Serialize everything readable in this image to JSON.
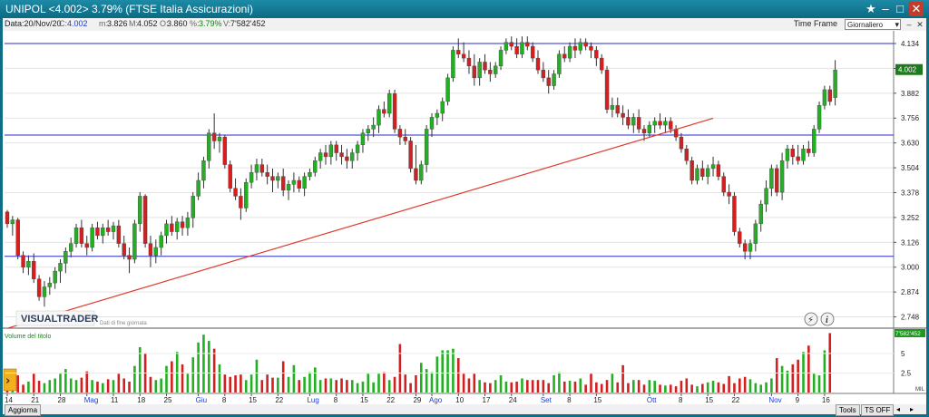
{
  "window": {
    "title": "UNIPOL <4.002> 3.79%  (FTSE Italia Assicurazioni)",
    "star_icon": "star-icon",
    "minimize_label": "–",
    "maximize_label": "□",
    "close_label": "✕"
  },
  "info": {
    "data": "Data:20/Nov/20",
    "close_label": "C:",
    "close": "4.002",
    "min_label": "m:",
    "min": "3.826",
    "max_label": "M:",
    "max": "4.052",
    "open_label": "O:",
    "open": "3.860",
    "pct_label": "%:",
    "pct": "3.79%",
    "vol_label": "V:",
    "vol": "7'582'452",
    "timeframe_label": "Time Frame",
    "timeframe_value": "Giornaliero",
    "colors": {
      "close": "#1a3ad6",
      "pct": "#0a8a0a"
    }
  },
  "status": {
    "aggiorna": "Aggiorna",
    "tools": "Tools",
    "ts_off": "TS OFF",
    "arrow_left": "◂",
    "arrow_right": "▸"
  },
  "chart_data": {
    "type": "candlestick",
    "price_axis": {
      "ticks": [
        "4.134",
        "4.008",
        "3.882",
        "3.756",
        "3.630",
        "3.504",
        "3.378",
        "3.252",
        "3.126",
        "3.000",
        "2.874",
        "2.748"
      ],
      "range": [
        2.7,
        4.18
      ]
    },
    "current_price_label": "4.002",
    "horizontal_lines": [
      4.134,
      3.67,
      3.055
    ],
    "trendline": {
      "from": [
        0,
        2.69
      ],
      "to": [
        133,
        3.755
      ]
    },
    "watermark": "VISUALTRADER",
    "watermark_sub": "Dati di fine giornata",
    "volume_pane": {
      "label": "Volume del titolo",
      "ticks": [
        "5",
        "2.5"
      ],
      "unit": "MIL",
      "last_label": "7'582'452",
      "range": [
        0,
        8
      ]
    },
    "x_ticks": [
      {
        "i": 0,
        "label": "14",
        "month": false
      },
      {
        "i": 5,
        "label": "21",
        "month": false
      },
      {
        "i": 10,
        "label": "28",
        "month": false
      },
      {
        "i": 15,
        "label": "Mag",
        "month": true
      },
      {
        "i": 20,
        "label": "11",
        "month": false
      },
      {
        "i": 25,
        "label": "18",
        "month": false
      },
      {
        "i": 30,
        "label": "25",
        "month": false
      },
      {
        "i": 36,
        "label": "Giu",
        "month": true
      },
      {
        "i": 41,
        "label": "8",
        "month": false
      },
      {
        "i": 46,
        "label": "15",
        "month": false
      },
      {
        "i": 51,
        "label": "22",
        "month": false
      },
      {
        "i": 57,
        "label": "Lug",
        "month": true
      },
      {
        "i": 62,
        "label": "8",
        "month": false
      },
      {
        "i": 67,
        "label": "15",
        "month": false
      },
      {
        "i": 72,
        "label": "22",
        "month": false
      },
      {
        "i": 77,
        "label": "29",
        "month": false
      },
      {
        "i": 80,
        "label": "Ago",
        "month": true
      },
      {
        "i": 85,
        "label": "10",
        "month": false
      },
      {
        "i": 90,
        "label": "17",
        "month": false
      },
      {
        "i": 95,
        "label": "24",
        "month": false
      },
      {
        "i": 101,
        "label": "Set",
        "month": true
      },
      {
        "i": 106,
        "label": "8",
        "month": false
      },
      {
        "i": 111,
        "label": "15",
        "month": false
      },
      {
        "i": 121,
        "label": "Ott",
        "month": true
      },
      {
        "i": 127,
        "label": "8",
        "month": false
      },
      {
        "i": 132,
        "label": "15",
        "month": false
      },
      {
        "i": 137,
        "label": "22",
        "month": false
      },
      {
        "i": 144,
        "label": "Nov",
        "month": true
      },
      {
        "i": 149,
        "label": "9",
        "month": false
      },
      {
        "i": 154,
        "label": "16",
        "month": false
      }
    ],
    "candles": [
      [
        3.28,
        3.29,
        3.2,
        3.22
      ],
      [
        3.22,
        3.26,
        3.16,
        3.24
      ],
      [
        3.24,
        3.25,
        3.04,
        3.06
      ],
      [
        3.06,
        3.08,
        2.97,
        3.0
      ],
      [
        3.0,
        3.06,
        2.96,
        3.03
      ],
      [
        3.03,
        3.07,
        2.92,
        2.94
      ],
      [
        2.94,
        2.96,
        2.83,
        2.85
      ],
      [
        2.85,
        2.93,
        2.8,
        2.9
      ],
      [
        2.9,
        2.95,
        2.86,
        2.92
      ],
      [
        2.92,
        3.0,
        2.89,
        2.98
      ],
      [
        2.98,
        3.04,
        2.92,
        3.02
      ],
      [
        3.02,
        3.1,
        2.97,
        3.08
      ],
      [
        3.08,
        3.15,
        3.05,
        3.12
      ],
      [
        3.12,
        3.22,
        3.1,
        3.2
      ],
      [
        3.2,
        3.24,
        3.1,
        3.12
      ],
      [
        3.12,
        3.16,
        3.06,
        3.1
      ],
      [
        3.1,
        3.22,
        3.08,
        3.2
      ],
      [
        3.2,
        3.23,
        3.14,
        3.16
      ],
      [
        3.16,
        3.22,
        3.12,
        3.2
      ],
      [
        3.2,
        3.24,
        3.16,
        3.18
      ],
      [
        3.18,
        3.23,
        3.14,
        3.21
      ],
      [
        3.21,
        3.24,
        3.1,
        3.12
      ],
      [
        3.12,
        3.16,
        3.04,
        3.06
      ],
      [
        3.06,
        3.1,
        2.97,
        3.04
      ],
      [
        3.04,
        3.24,
        3.02,
        3.22
      ],
      [
        3.22,
        3.38,
        3.18,
        3.36
      ],
      [
        3.36,
        3.37,
        3.1,
        3.12
      ],
      [
        3.12,
        3.16,
        3.0,
        3.06
      ],
      [
        3.06,
        3.14,
        3.02,
        3.1
      ],
      [
        3.1,
        3.18,
        3.06,
        3.16
      ],
      [
        3.16,
        3.24,
        3.12,
        3.22
      ],
      [
        3.22,
        3.26,
        3.16,
        3.18
      ],
      [
        3.18,
        3.25,
        3.14,
        3.23
      ],
      [
        3.23,
        3.26,
        3.16,
        3.2
      ],
      [
        3.2,
        3.28,
        3.16,
        3.25
      ],
      [
        3.25,
        3.38,
        3.2,
        3.36
      ],
      [
        3.36,
        3.48,
        3.34,
        3.44
      ],
      [
        3.44,
        3.56,
        3.4,
        3.54
      ],
      [
        3.54,
        3.7,
        3.5,
        3.68
      ],
      [
        3.68,
        3.78,
        3.6,
        3.64
      ],
      [
        3.64,
        3.68,
        3.58,
        3.66
      ],
      [
        3.66,
        3.67,
        3.5,
        3.52
      ],
      [
        3.52,
        3.54,
        3.38,
        3.4
      ],
      [
        3.4,
        3.45,
        3.34,
        3.36
      ],
      [
        3.36,
        3.4,
        3.24,
        3.3
      ],
      [
        3.3,
        3.45,
        3.28,
        3.43
      ],
      [
        3.43,
        3.52,
        3.4,
        3.48
      ],
      [
        3.48,
        3.55,
        3.44,
        3.52
      ],
      [
        3.52,
        3.55,
        3.46,
        3.48
      ],
      [
        3.48,
        3.52,
        3.42,
        3.46
      ],
      [
        3.46,
        3.5,
        3.38,
        3.44
      ],
      [
        3.44,
        3.48,
        3.4,
        3.46
      ],
      [
        3.46,
        3.5,
        3.36,
        3.39
      ],
      [
        3.39,
        3.44,
        3.34,
        3.42
      ],
      [
        3.42,
        3.48,
        3.38,
        3.44
      ],
      [
        3.44,
        3.46,
        3.38,
        3.4
      ],
      [
        3.4,
        3.48,
        3.36,
        3.46
      ],
      [
        3.46,
        3.5,
        3.44,
        3.48
      ],
      [
        3.48,
        3.56,
        3.46,
        3.54
      ],
      [
        3.54,
        3.6,
        3.5,
        3.58
      ],
      [
        3.58,
        3.62,
        3.52,
        3.56
      ],
      [
        3.56,
        3.64,
        3.52,
        3.62
      ],
      [
        3.62,
        3.64,
        3.54,
        3.58
      ],
      [
        3.58,
        3.62,
        3.52,
        3.56
      ],
      [
        3.56,
        3.6,
        3.5,
        3.54
      ],
      [
        3.54,
        3.6,
        3.5,
        3.58
      ],
      [
        3.58,
        3.64,
        3.54,
        3.62
      ],
      [
        3.62,
        3.7,
        3.58,
        3.68
      ],
      [
        3.68,
        3.72,
        3.64,
        3.7
      ],
      [
        3.7,
        3.76,
        3.66,
        3.72
      ],
      [
        3.72,
        3.82,
        3.68,
        3.8
      ],
      [
        3.8,
        3.84,
        3.76,
        3.78
      ],
      [
        3.78,
        3.9,
        3.76,
        3.88
      ],
      [
        3.88,
        3.9,
        3.68,
        3.7
      ],
      [
        3.7,
        3.72,
        3.62,
        3.66
      ],
      [
        3.66,
        3.7,
        3.62,
        3.64
      ],
      [
        3.64,
        3.66,
        3.48,
        3.5
      ],
      [
        3.5,
        3.62,
        3.42,
        3.44
      ],
      [
        3.44,
        3.54,
        3.42,
        3.52
      ],
      [
        3.52,
        3.72,
        3.48,
        3.7
      ],
      [
        3.7,
        3.78,
        3.66,
        3.76
      ],
      [
        3.76,
        3.8,
        3.72,
        3.78
      ],
      [
        3.78,
        3.86,
        3.74,
        3.84
      ],
      [
        3.84,
        3.98,
        3.82,
        3.96
      ],
      [
        3.96,
        4.12,
        3.94,
        4.1
      ],
      [
        4.1,
        4.16,
        4.06,
        4.08
      ],
      [
        4.08,
        4.14,
        4.04,
        4.06
      ],
      [
        4.06,
        4.1,
        3.98,
        4.02
      ],
      [
        4.02,
        4.08,
        3.92,
        3.96
      ],
      [
        3.96,
        4.06,
        3.92,
        4.04
      ],
      [
        4.04,
        4.08,
        3.98,
        4.0
      ],
      [
        4.0,
        4.04,
        3.94,
        3.98
      ],
      [
        3.98,
        4.04,
        3.96,
        4.02
      ],
      [
        4.02,
        4.12,
        4.0,
        4.1
      ],
      [
        4.1,
        4.16,
        4.08,
        4.14
      ],
      [
        4.14,
        4.17,
        4.1,
        4.12
      ],
      [
        4.12,
        4.16,
        4.06,
        4.08
      ],
      [
        4.08,
        4.17,
        4.06,
        4.14
      ],
      [
        4.14,
        4.17,
        4.1,
        4.12
      ],
      [
        4.12,
        4.14,
        4.04,
        4.06
      ],
      [
        4.06,
        4.1,
        3.98,
        4.0
      ],
      [
        4.0,
        4.04,
        3.94,
        3.96
      ],
      [
        3.96,
        4.0,
        3.88,
        3.92
      ],
      [
        3.92,
        4.0,
        3.9,
        3.98
      ],
      [
        3.98,
        4.1,
        3.96,
        4.08
      ],
      [
        4.08,
        4.12,
        4.04,
        4.06
      ],
      [
        4.06,
        4.14,
        4.04,
        4.12
      ],
      [
        4.12,
        4.16,
        4.06,
        4.1
      ],
      [
        4.1,
        4.16,
        4.08,
        4.14
      ],
      [
        4.14,
        4.16,
        4.1,
        4.12
      ],
      [
        4.12,
        4.14,
        4.06,
        4.1
      ],
      [
        4.1,
        4.12,
        4.02,
        4.06
      ],
      [
        4.06,
        4.08,
        3.98,
        4.0
      ],
      [
        4.0,
        4.02,
        3.78,
        3.8
      ],
      [
        3.8,
        3.86,
        3.76,
        3.82
      ],
      [
        3.82,
        3.86,
        3.76,
        3.78
      ],
      [
        3.78,
        3.82,
        3.72,
        3.76
      ],
      [
        3.76,
        3.8,
        3.7,
        3.72
      ],
      [
        3.72,
        3.78,
        3.68,
        3.76
      ],
      [
        3.76,
        3.8,
        3.68,
        3.7
      ],
      [
        3.7,
        3.72,
        3.64,
        3.68
      ],
      [
        3.68,
        3.74,
        3.66,
        3.72
      ],
      [
        3.72,
        3.76,
        3.68,
        3.74
      ],
      [
        3.74,
        3.78,
        3.7,
        3.72
      ],
      [
        3.72,
        3.76,
        3.68,
        3.74
      ],
      [
        3.74,
        3.76,
        3.68,
        3.7
      ],
      [
        3.7,
        3.72,
        3.64,
        3.66
      ],
      [
        3.66,
        3.68,
        3.58,
        3.6
      ],
      [
        3.6,
        3.62,
        3.52,
        3.54
      ],
      [
        3.54,
        3.56,
        3.42,
        3.44
      ],
      [
        3.44,
        3.52,
        3.42,
        3.5
      ],
      [
        3.5,
        3.54,
        3.44,
        3.46
      ],
      [
        3.46,
        3.52,
        3.42,
        3.5
      ],
      [
        3.5,
        3.56,
        3.46,
        3.52
      ],
      [
        3.52,
        3.54,
        3.44,
        3.46
      ],
      [
        3.46,
        3.48,
        3.36,
        3.38
      ],
      [
        3.38,
        3.42,
        3.32,
        3.36
      ],
      [
        3.36,
        3.38,
        3.16,
        3.18
      ],
      [
        3.18,
        3.2,
        3.1,
        3.12
      ],
      [
        3.12,
        3.14,
        3.04,
        3.08
      ],
      [
        3.08,
        3.14,
        3.04,
        3.12
      ],
      [
        3.12,
        3.24,
        3.08,
        3.22
      ],
      [
        3.22,
        3.34,
        3.18,
        3.32
      ],
      [
        3.32,
        3.44,
        3.28,
        3.4
      ],
      [
        3.4,
        3.52,
        3.36,
        3.5
      ],
      [
        3.5,
        3.52,
        3.36,
        3.38
      ],
      [
        3.38,
        3.58,
        3.34,
        3.54
      ],
      [
        3.54,
        3.62,
        3.5,
        3.6
      ],
      [
        3.6,
        3.62,
        3.52,
        3.56
      ],
      [
        3.56,
        3.62,
        3.52,
        3.54
      ],
      [
        3.54,
        3.62,
        3.52,
        3.6
      ],
      [
        3.6,
        3.64,
        3.56,
        3.58
      ],
      [
        3.58,
        3.72,
        3.56,
        3.7
      ],
      [
        3.7,
        3.84,
        3.68,
        3.82
      ],
      [
        3.82,
        3.92,
        3.8,
        3.9
      ],
      [
        3.9,
        3.92,
        3.82,
        3.84
      ],
      [
        3.86,
        4.05,
        3.82,
        4.0
      ]
    ],
    "volumes": [
      1.6,
      1.2,
      2.2,
      1.0,
      1.4,
      2.4,
      1.5,
      1.2,
      1.6,
      1.8,
      2.4,
      3.0,
      1.8,
      1.6,
      1.9,
      2.7,
      1.6,
      1.4,
      1.2,
      1.7,
      1.6,
      2.4,
      1.8,
      1.4,
      3.4,
      5.8,
      5.0,
      2.0,
      1.6,
      1.8,
      3.4,
      4.0,
      5.2,
      3.6,
      2.4,
      4.5,
      6.4,
      7.4,
      6.6,
      5.6,
      3.6,
      2.3,
      2.0,
      2.2,
      2.3,
      1.6,
      2.3,
      4.2,
      1.6,
      2.3,
      1.9,
      1.9,
      4.0,
      2.0,
      3.5,
      1.6,
      2.0,
      2.6,
      3.2,
      1.6,
      1.8,
      1.8,
      1.6,
      1.8,
      1.6,
      1.6,
      1.2,
      1.4,
      2.4,
      1.3,
      2.4,
      2.6,
      1.6,
      2.0,
      6.2,
      2.3,
      1.2,
      2.2,
      3.8,
      3.0,
      2.6,
      4.6,
      5.4,
      5.4,
      5.6,
      4.4,
      2.4,
      1.8,
      2.4,
      1.6,
      1.3,
      1.2,
      1.6,
      2.2,
      1.4,
      1.3,
      1.4,
      1.8,
      1.6,
      1.6,
      1.6,
      1.6,
      1.2,
      2.2,
      2.6,
      1.4,
      1.5,
      1.4,
      1.8,
      1.0,
      2.4,
      1.3,
      1.1,
      1.6,
      2.4,
      1.3,
      3.5,
      1.2,
      1.6,
      1.6,
      1.0,
      1.6,
      1.5,
      1.0,
      0.9,
      1.0,
      0.8,
      1.5,
      1.8,
      1.0,
      0.8,
      1.1,
      1.3,
      1.5,
      1.3,
      1.1,
      2.1,
      1.2,
      1.8,
      2.0,
      1.7,
      1.2,
      1.0,
      1.3,
      1.8,
      4.4,
      3.4,
      2.8,
      3.6,
      4.2,
      5.2,
      6.0,
      2.4,
      2.2,
      5.4,
      7.6
    ]
  }
}
